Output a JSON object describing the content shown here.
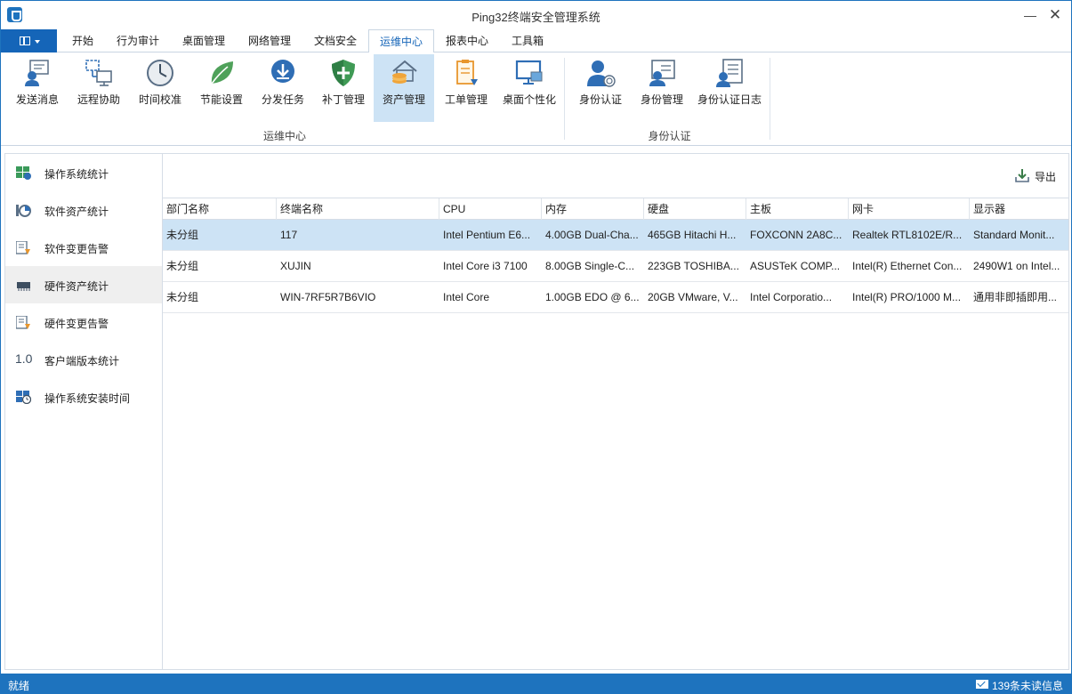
{
  "window": {
    "title": "Ping32终端安全管理系统",
    "minimize": "—",
    "close": "✕"
  },
  "tabs": [
    {
      "label": "开始"
    },
    {
      "label": "行为审计"
    },
    {
      "label": "桌面管理"
    },
    {
      "label": "网络管理"
    },
    {
      "label": "文档安全"
    },
    {
      "label": "运维中心",
      "active": true
    },
    {
      "label": "报表中心"
    },
    {
      "label": "工具箱"
    }
  ],
  "ribbon": {
    "groups": [
      {
        "label": "运维中心"
      },
      {
        "label": "身份认证"
      }
    ],
    "buttons": [
      {
        "label": "发送消息",
        "icon": "send-message-icon"
      },
      {
        "label": "远程协助",
        "icon": "remote-assist-icon"
      },
      {
        "label": "时间校准",
        "icon": "clock-icon"
      },
      {
        "label": "节能设置",
        "icon": "leaf-icon"
      },
      {
        "label": "分发任务",
        "icon": "download-icon"
      },
      {
        "label": "补丁管理",
        "icon": "shield-icon"
      },
      {
        "label": "资产管理",
        "icon": "asset-house-icon",
        "active": true
      },
      {
        "label": "工单管理",
        "icon": "clipboard-icon"
      },
      {
        "label": "桌面个性化",
        "icon": "desktop-icon"
      },
      {
        "label": "身份认证",
        "icon": "fingerprint-user-icon"
      },
      {
        "label": "身份管理",
        "icon": "id-card-icon"
      },
      {
        "label": "身份认证日志",
        "icon": "auth-log-icon"
      }
    ]
  },
  "sidebar": {
    "items": [
      {
        "label": "操作系统统计",
        "icon": "os-stats-icon"
      },
      {
        "label": "软件资产统计",
        "icon": "software-stats-icon"
      },
      {
        "label": "软件变更告警",
        "icon": "software-alert-icon"
      },
      {
        "label": "硬件资产统计",
        "icon": "hardware-chip-icon",
        "active": true
      },
      {
        "label": "硬件变更告警",
        "icon": "hardware-alert-icon"
      },
      {
        "label": "客户端版本统计",
        "icon": "version-icon",
        "icon_text": "1.0"
      },
      {
        "label": "操作系统安装时间",
        "icon": "os-install-time-icon"
      }
    ]
  },
  "main": {
    "export_label": "导出",
    "table": {
      "columns": [
        "部门名称",
        "终端名称",
        "CPU",
        "内存",
        "硬盘",
        "主板",
        "网卡",
        "显示器"
      ],
      "rows": [
        [
          "未分组",
          "117",
          "Intel Pentium E6...",
          "4.00GB Dual-Cha...",
          "465GB Hitachi H...",
          "FOXCONN 2A8C...",
          "Realtek RTL8102E/R...",
          "Standard Monit..."
        ],
        [
          "未分组",
          "XUJIN",
          "Intel Core i3 7100",
          "8.00GB Single-C...",
          "223GB TOSHIBA...",
          "ASUSTeK COMP...",
          "Intel(R) Ethernet Con...",
          "2490W1 on Intel..."
        ],
        [
          "未分组",
          "WIN-7RF5R7B6VIO",
          "Intel Core",
          "1.00GB EDO @ 6...",
          "20GB VMware, V...",
          "Intel Corporatio...",
          "Intel(R) PRO/1000 M...",
          "通用非即插即用..."
        ]
      ]
    }
  },
  "status": {
    "left": "就绪",
    "right": "139条未读信息"
  },
  "colors": {
    "accent": "#1e73be",
    "selected_row": "#cde3f5",
    "active_ribbon": "#cde3f5"
  }
}
